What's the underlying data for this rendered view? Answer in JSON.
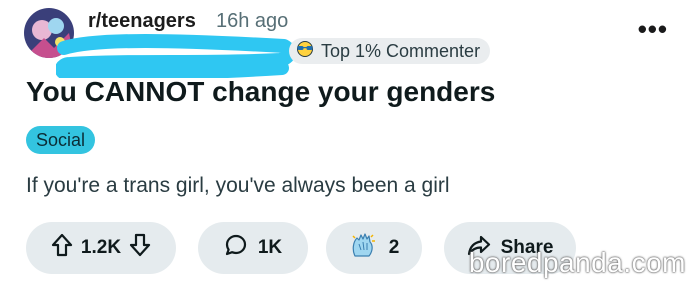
{
  "post": {
    "subreddit": "r/teenagers",
    "time_ago": "16h ago",
    "flair_badge": "Top 1% Commenter",
    "title": "You CANNOT change your genders",
    "tag": "Social",
    "body": "If you're a trans girl, you've always been a girl"
  },
  "actions": {
    "upvotes": "1.2K",
    "comments": "1K",
    "awards": "2",
    "share_label": "Share"
  },
  "watermark": "boredpanda.com",
  "colors": {
    "tag_bg": "#33c4e0",
    "redaction": "#2fc7f2",
    "pill_bg": "#e5ebee"
  }
}
